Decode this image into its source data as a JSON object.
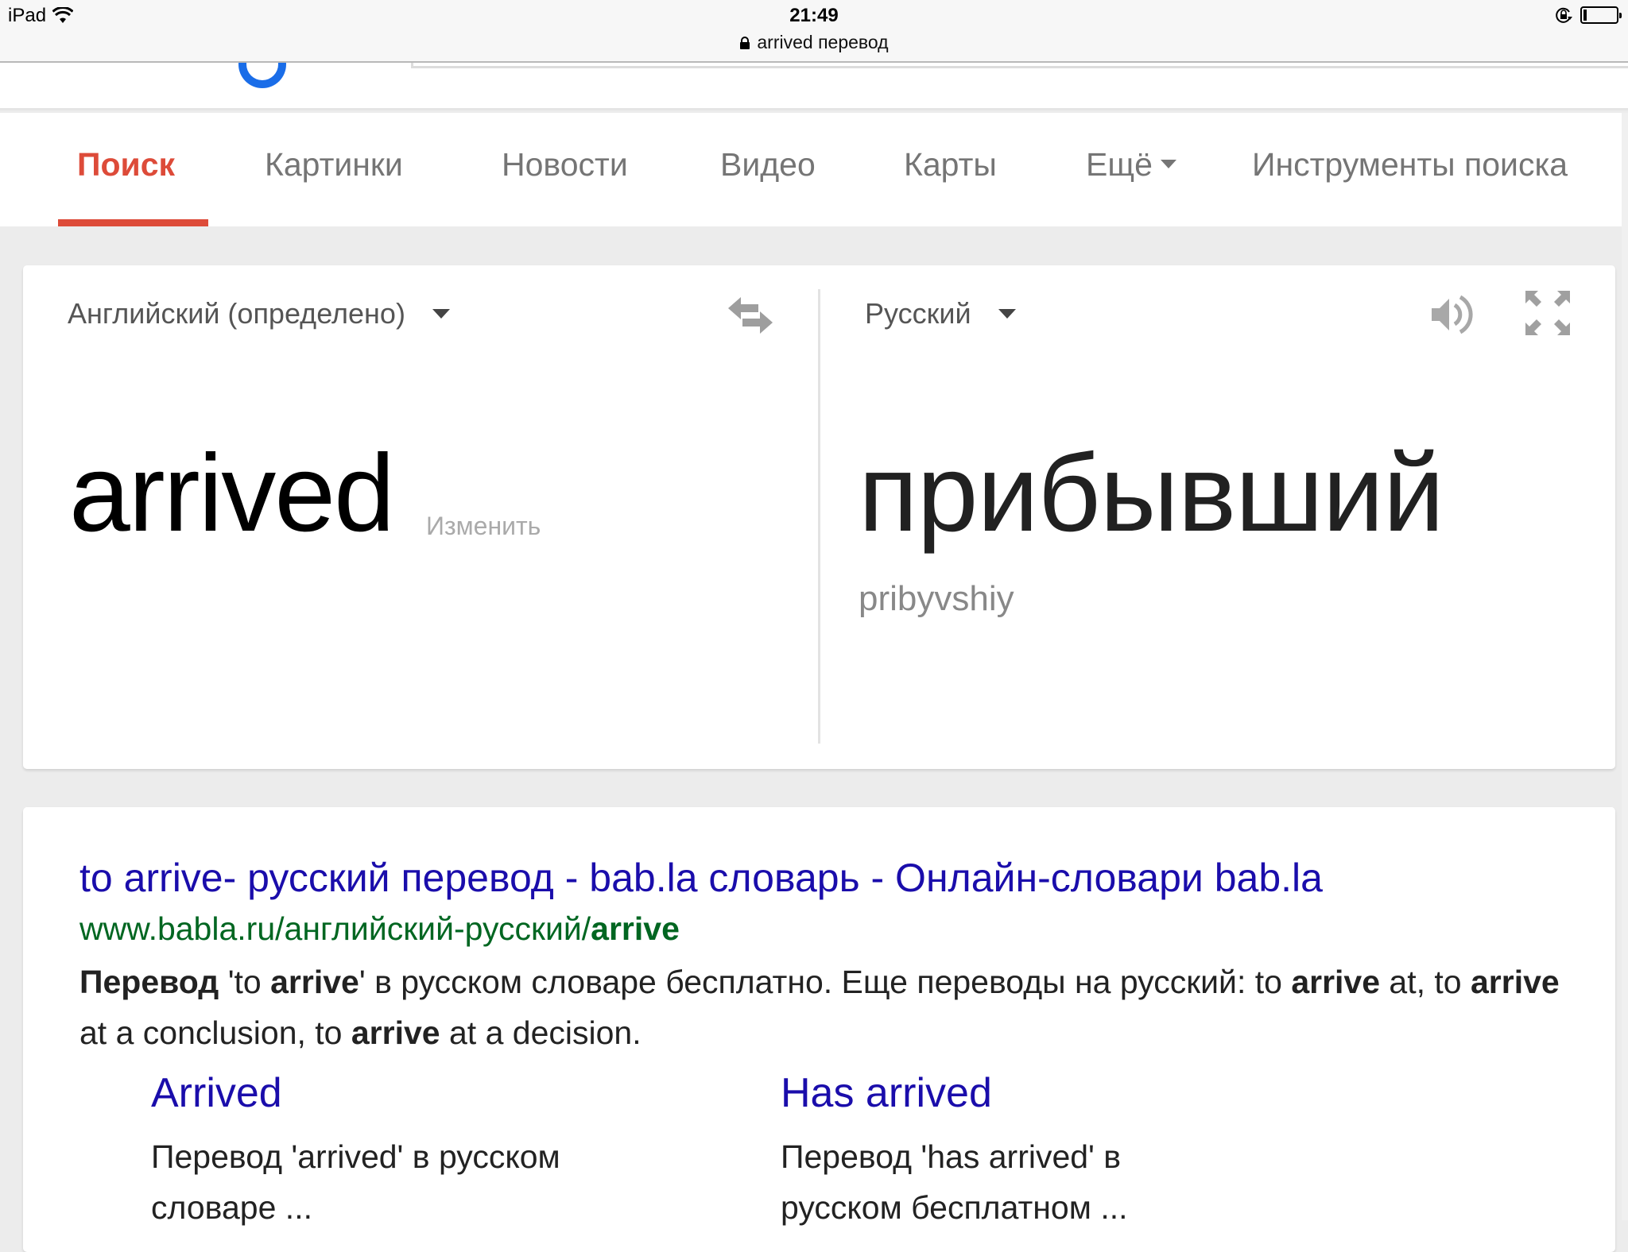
{
  "status_bar": {
    "device": "iPad",
    "time": "21:49",
    "url_title": "arrived перевод",
    "icons": [
      "wifi-icon",
      "lock-icon",
      "rotation-lock-icon",
      "battery-icon"
    ]
  },
  "tabs": [
    {
      "label": "Поиск",
      "active": true
    },
    {
      "label": "Картинки",
      "active": false
    },
    {
      "label": "Новости",
      "active": false
    },
    {
      "label": "Видео",
      "active": false
    },
    {
      "label": "Карты",
      "active": false
    },
    {
      "label": "Ещё",
      "active": false,
      "has_dropdown": true
    },
    {
      "label": "Инструменты поиска",
      "active": false
    }
  ],
  "translate": {
    "source_lang": "Английский (определено)",
    "target_lang": "Русский",
    "source_text": "arrived",
    "edit_label": "Изменить",
    "target_text": "прибывший",
    "transliteration": "pribyvshiy",
    "icons": [
      "swap-languages-icon",
      "speaker-icon",
      "expand-icon"
    ]
  },
  "result": {
    "title": "to arrive- русский перевод - bab.la словарь - Онлайн-словари bab.la",
    "url_prefix": "www.babla.ru/английский-русский/",
    "url_bold": "arrive",
    "snippet": [
      {
        "t": "Перевод",
        "b": true
      },
      {
        "t": " 'to ",
        "b": false
      },
      {
        "t": "arrive",
        "b": true
      },
      {
        "t": "' в русском словаре бесплатно. Еще переводы на русский: to ",
        "b": false
      },
      {
        "t": "arrive",
        "b": true
      },
      {
        "t": " at, to ",
        "b": false
      },
      {
        "t": "arrive",
        "b": true
      },
      {
        "t": " at a conclusion, to ",
        "b": false
      },
      {
        "t": "arrive",
        "b": true
      },
      {
        "t": " at a decision.",
        "b": false
      }
    ],
    "sublinks": [
      {
        "title": "Arrived",
        "desc": "Перевод 'arrived' в русском словаре ..."
      },
      {
        "title": "Has arrived",
        "desc": "Перевод 'has arrived' в русском бесплатном ..."
      }
    ]
  },
  "colors": {
    "active_tab": "#dd4b39",
    "link": "#1a0dab",
    "url": "#006621",
    "background": "#ececec"
  }
}
